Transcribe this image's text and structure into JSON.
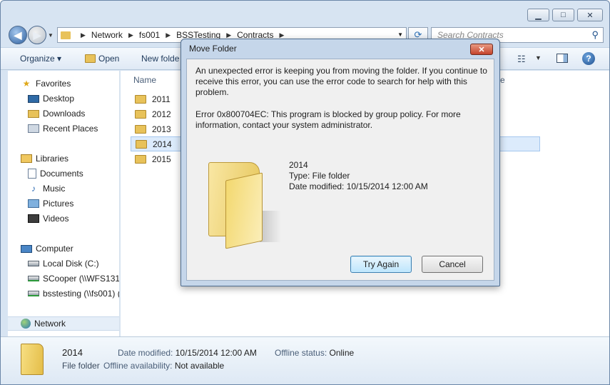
{
  "window": {
    "minimize_glyph": "▁",
    "maximize_glyph": "□",
    "close_glyph": "✕"
  },
  "address": {
    "crumbs": [
      "Network",
      "fs001",
      "BSSTesting",
      "Contracts"
    ],
    "separator": "▶",
    "search_placeholder": "Search Contracts"
  },
  "command_bar": {
    "organize": "Organize ▾",
    "open": "Open",
    "new_folder": "New folde"
  },
  "nav": {
    "favorites": "Favorites",
    "desktop": "Desktop",
    "downloads": "Downloads",
    "recent_places": "Recent Places",
    "libraries": "Libraries",
    "documents": "Documents",
    "music": "Music",
    "pictures": "Pictures",
    "videos": "Videos",
    "computer": "Computer",
    "local_disk": "Local Disk (C:)",
    "scooper": "SCooper (\\\\WFS131.",
    "bsstesting": "bsstesting (\\\\fs001) (",
    "network": "Network"
  },
  "file_list": {
    "col_name": "Name",
    "col_right": "e",
    "folders": [
      "2011",
      "2012",
      "2013",
      "2014",
      "2015"
    ],
    "selected_index": 3
  },
  "details": {
    "name": "2014",
    "type": "File folder",
    "date_modified_label": "Date modified:",
    "date_modified_value": "10/15/2014 12:00 AM",
    "offline_status_label": "Offline status:",
    "offline_status_value": "Online",
    "offline_availability_label": "Offline availability:",
    "offline_availability_value": "Not available"
  },
  "dialog": {
    "title": "Move Folder",
    "message": "An unexpected error is keeping you from moving the folder. If you continue to receive this error, you can use the error code to search for help with this problem.",
    "error": "Error 0x800704EC: This program is blocked by group policy. For more information, contact your system administrator.",
    "item_name": "2014",
    "item_type": "Type: File folder",
    "item_modified": "Date modified: 10/15/2014 12:00 AM",
    "try_again": "Try Again",
    "cancel": "Cancel"
  },
  "icons": {
    "back": "back-arrow-icon",
    "forward": "forward-arrow-icon",
    "refresh": "refresh-icon",
    "search": "search-icon",
    "help": "help-icon",
    "accent_color": "#3c7fb1"
  }
}
